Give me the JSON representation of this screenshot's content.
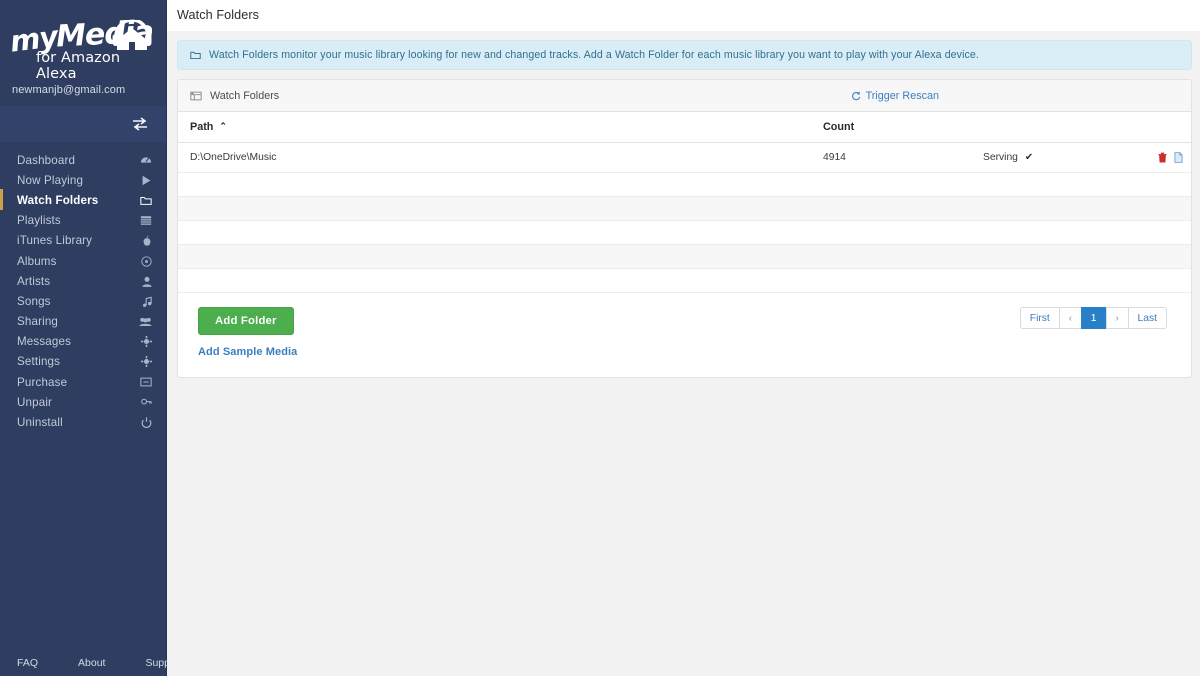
{
  "sidebar": {
    "logo": {
      "my": "my",
      "media": "Media",
      "sub": "for Amazon Alexa",
      "icon": "house-headphones-icon"
    },
    "email": "newmanjb@gmail.com",
    "toggle_icon": "exchange-arrows-icon",
    "items": [
      {
        "label": "Dashboard",
        "icon": "dashboard-icon",
        "active": false
      },
      {
        "label": "Now Playing",
        "icon": "play-icon",
        "active": false
      },
      {
        "label": "Watch Folders",
        "icon": "folder-icon",
        "active": true
      },
      {
        "label": "Playlists",
        "icon": "list-icon",
        "active": false
      },
      {
        "label": "iTunes Library",
        "icon": "apple-icon",
        "active": false
      },
      {
        "label": "Albums",
        "icon": "disc-icon",
        "active": false
      },
      {
        "label": "Artists",
        "icon": "user-icon",
        "active": false
      },
      {
        "label": "Songs",
        "icon": "music-note-icon",
        "active": false
      },
      {
        "label": "Sharing",
        "icon": "users-icon",
        "active": false
      },
      {
        "label": "Messages",
        "icon": "gear-icon",
        "active": false
      },
      {
        "label": "Settings",
        "icon": "gear-icon",
        "active": false
      },
      {
        "label": "Purchase",
        "icon": "card-icon",
        "active": false
      },
      {
        "label": "Unpair",
        "icon": "key-icon",
        "active": false
      },
      {
        "label": "Uninstall",
        "icon": "power-icon",
        "active": false
      }
    ],
    "footer": {
      "faq": "FAQ",
      "about": "About",
      "support": "Support"
    }
  },
  "header": {
    "title": "Watch Folders"
  },
  "alert": {
    "icon": "folder-icon",
    "text": "Watch Folders monitor your music library looking for new and changed tracks. Add a Watch Folder for each music library you want to play with your Alexa device."
  },
  "panel": {
    "icon": "table-list-icon",
    "title": "Watch Folders",
    "rescan_label": "Trigger Rescan",
    "rescan_icon": "refresh-icon"
  },
  "table": {
    "columns": [
      "Path",
      "Count",
      "",
      ""
    ],
    "sort": {
      "column": "Path",
      "direction": "asc",
      "caret": "⌃"
    },
    "rows": [
      {
        "path": "D:\\OneDrive\\Music",
        "count": "4914",
        "status": "Serving",
        "status_check": "✔",
        "delete_icon": "trash-icon",
        "log_icon": "file-icon"
      }
    ],
    "empty_row_count": 5
  },
  "footer": {
    "add_folder_label": "Add Folder",
    "add_sample_label": "Add Sample Media",
    "pagination": {
      "first": "First",
      "prev": "‹",
      "current": "1",
      "next": "›",
      "last": "Last"
    }
  },
  "colors": {
    "sidebar_bg": "#2e3d60",
    "accent_active": "#c9a14a",
    "link_blue": "#3a7fbf",
    "primary_blue": "#2a7fc9",
    "success_green": "#4cae4c",
    "alert_bg": "#d9edf7",
    "alert_text": "#31708f",
    "danger_red": "#c9302c"
  }
}
